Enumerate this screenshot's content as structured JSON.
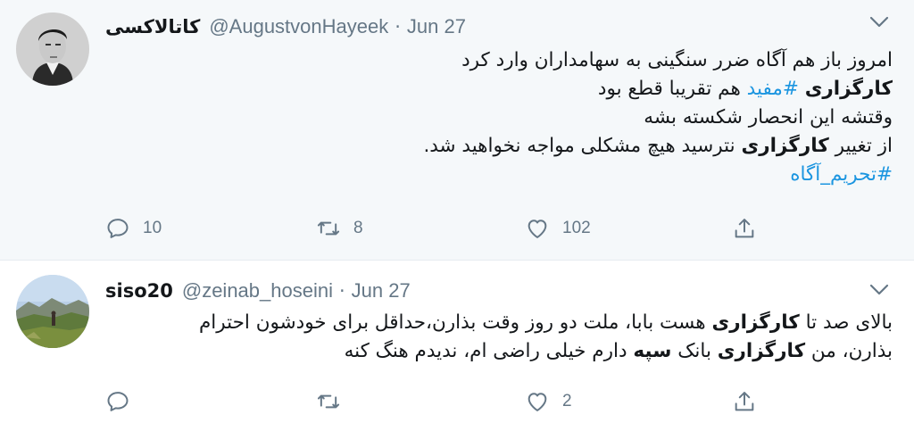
{
  "tweets": [
    {
      "display_name": "کاتالاکسی",
      "handle": "@AugustvonHayeek",
      "separator": "·",
      "date": "Jun 27",
      "lines": [
        [
          {
            "t": "امروز باز هم آگاه ضرر سنگینی به سهامداران وارد کرد",
            "s": "n"
          }
        ],
        [
          {
            "t": "کارگزاری",
            "s": "b"
          },
          {
            "t": " ",
            "s": "n"
          },
          {
            "t": "#مفید",
            "s": "h"
          },
          {
            "t": " هم تقریبا قطع بود",
            "s": "n"
          }
        ],
        [
          {
            "t": "وقتشه این انحصار شکسته بشه",
            "s": "n"
          }
        ],
        [
          {
            "t": "از تغییر ",
            "s": "n"
          },
          {
            "t": "کارگزاری",
            "s": "b"
          },
          {
            "t": " نترسید هیچ مشکلی مواجه نخواهید شد.",
            "s": "n"
          }
        ],
        [
          {
            "t": "#تحریم_آگاه",
            "s": "h"
          }
        ]
      ],
      "replies": "10",
      "retweets": "8",
      "likes": "102"
    },
    {
      "display_name": "siso20",
      "handle": "@zeinab_hoseini",
      "separator": "·",
      "date": "Jun 27",
      "lines": [
        [
          {
            "t": "بالای صد تا ",
            "s": "n"
          },
          {
            "t": "کارگزاری",
            "s": "b"
          },
          {
            "t": " هست بابا، ملت دو روز وقت بذارن،حداقل برای خودشون احترام",
            "s": "n"
          }
        ],
        [
          {
            "t": "بذارن، من ",
            "s": "n"
          },
          {
            "t": "کارگزاری",
            "s": "b"
          },
          {
            "t": " بانک ",
            "s": "n"
          },
          {
            "t": "سپه",
            "s": "b"
          },
          {
            "t": " دارم خیلی راضی ام، ندیدم هنگ کنه",
            "s": "n"
          }
        ]
      ],
      "replies": "",
      "retweets": "",
      "likes": "2"
    }
  ],
  "icons": {
    "reply": "reply-icon",
    "retweet": "retweet-icon",
    "like": "heart-icon",
    "share": "share-icon",
    "more": "chevron-down-icon"
  },
  "colors": {
    "hashtag": "#1b95e0",
    "muted": "#657786",
    "thread_line": "#ccd6dd",
    "highlight_bg": "#f5f8fa"
  }
}
